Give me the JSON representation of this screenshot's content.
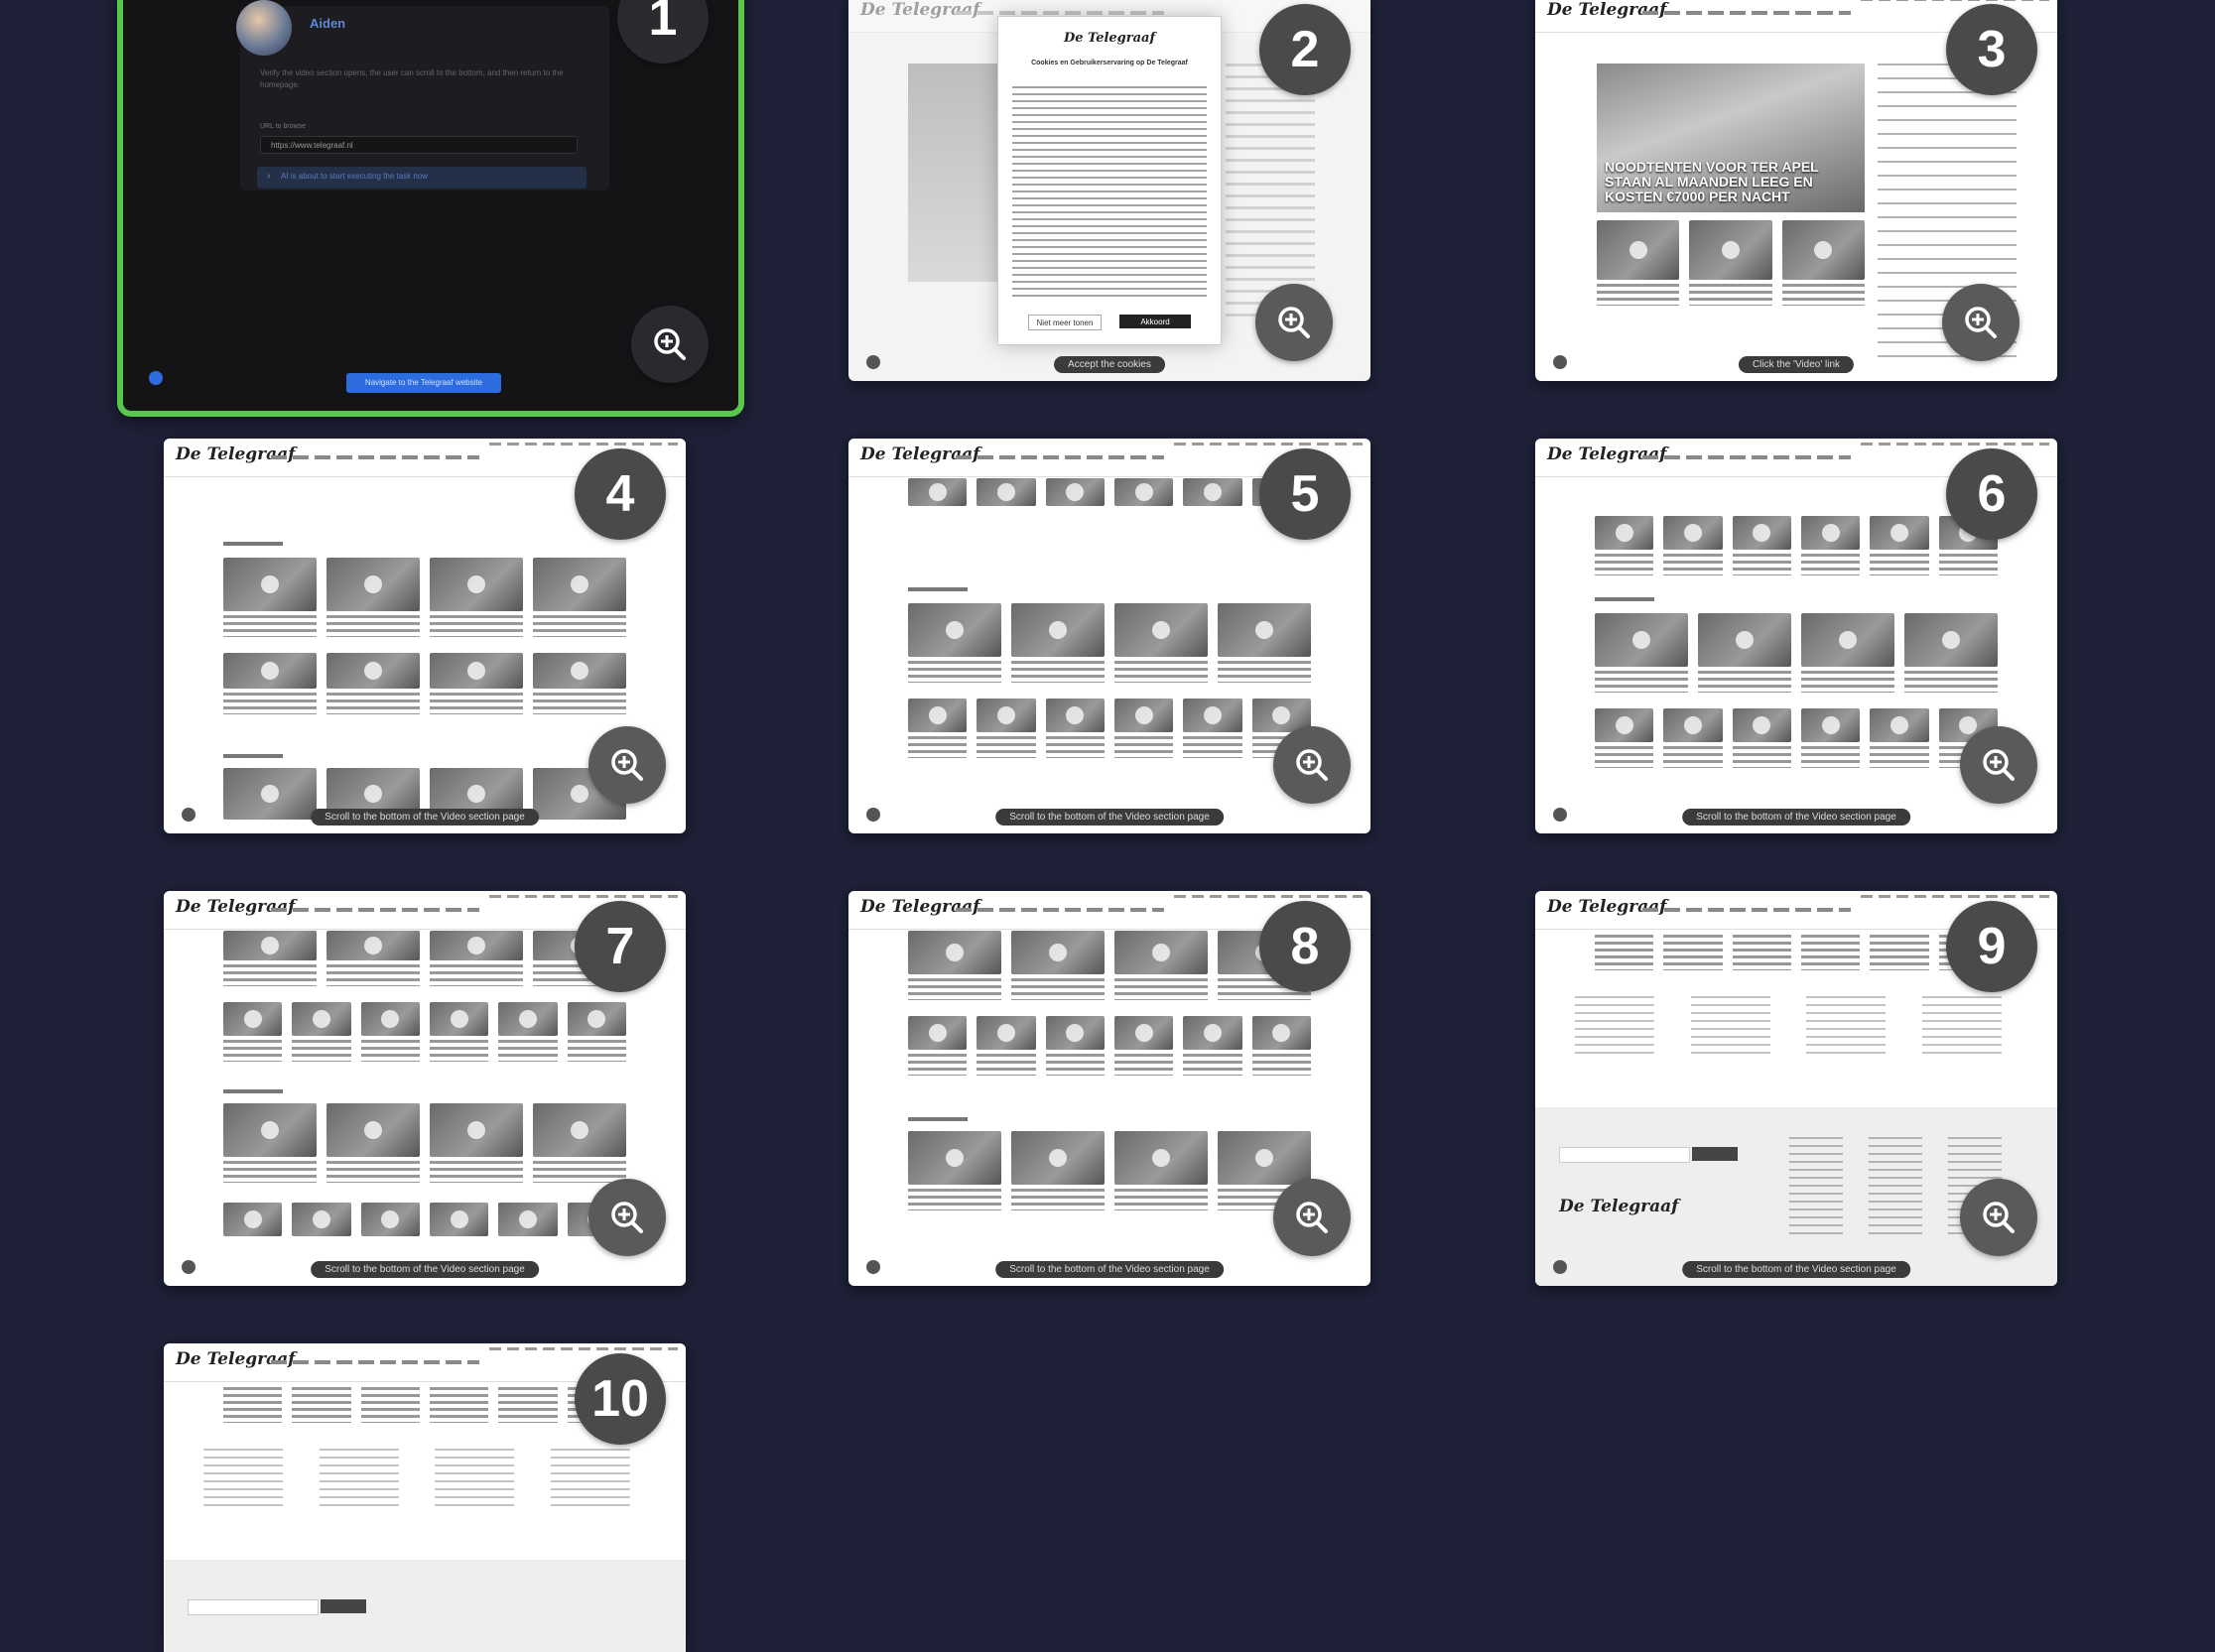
{
  "agent_panel": {
    "user_name": "Aiden",
    "instruction": "Verify the video section opens, the user can scroll to the bottom, and then return to the homepage.",
    "url_label": "URL to browse",
    "url_value": "https://www.telegraaf.nl",
    "step_text": "AI is about to start executing the task now",
    "action_button": "Navigate to the Telegraaf website"
  },
  "site": {
    "logo_text": "De Telegraaf"
  },
  "cards": [
    {
      "num": "1",
      "status": ""
    },
    {
      "num": "2",
      "status": "Accept the cookies",
      "modal_title": "De Telegraaf",
      "modal_subtitle": "Cookies en Gebruikerservaring op De Telegraaf",
      "modal_btn_reject": "Niet meer tonen",
      "modal_btn_accept": "Akkoord"
    },
    {
      "num": "3",
      "status": "Click the 'Video' link",
      "headline": "NOODTENTEN VOOR TER APEL STAAN AL MAANDEN LEEG EN KOSTEN €7000 PER NACHT"
    },
    {
      "num": "4",
      "status": "Scroll to the bottom of the Video section page"
    },
    {
      "num": "5",
      "status": "Scroll to the bottom of the Video section page"
    },
    {
      "num": "6",
      "status": "Scroll to the bottom of the Video section page"
    },
    {
      "num": "7",
      "status": "Scroll to the bottom of the Video section page"
    },
    {
      "num": "8",
      "status": "Scroll to the bottom of the Video section page"
    },
    {
      "num": "9",
      "status": "Scroll to the bottom of the Video section page"
    },
    {
      "num": "10",
      "status": ""
    }
  ],
  "colors": {
    "background": "#1e2137",
    "active_border": "#57c84d",
    "badge": "#4a4a4a"
  }
}
